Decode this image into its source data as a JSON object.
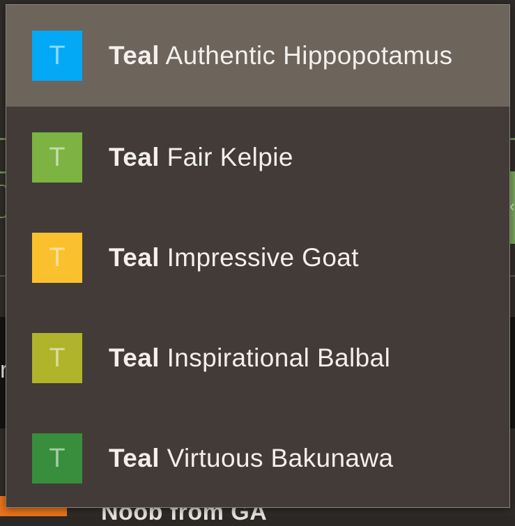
{
  "dropdown": {
    "items": [
      {
        "team": "Teal",
        "name": "Authentic Hippopotamus",
        "initial": "T",
        "color": "#03a9f4",
        "selected": true
      },
      {
        "team": "Teal",
        "name": "Fair Kelpie",
        "initial": "T",
        "color": "#7cb342",
        "selected": false
      },
      {
        "team": "Teal",
        "name": "Impressive Goat",
        "initial": "T",
        "color": "#fbc02d",
        "selected": false
      },
      {
        "team": "Teal",
        "name": "Inspirational Balbal",
        "initial": "T",
        "color": "#afb42b",
        "selected": false
      },
      {
        "team": "Teal",
        "name": "Virtuous Bakunawa",
        "initial": "T",
        "color": "#388e3c",
        "selected": false
      }
    ]
  },
  "background": {
    "bottom_text": "Noob from GA",
    "left_glyph": "r",
    "right_glyph": "‹"
  }
}
